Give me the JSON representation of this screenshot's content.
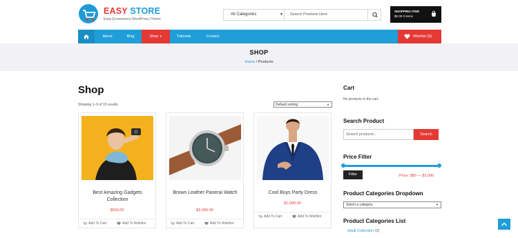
{
  "brand": {
    "name_part1": "EASY",
    "name_part2": "STORE",
    "tagline": "Easy-Ecommerce-WordPress-Theme",
    "colors": {
      "red": "#e53935",
      "blue": "#1e9bd7",
      "dark": "#111111"
    }
  },
  "search": {
    "category_value": "All Categories",
    "placeholder": "Search Products Here"
  },
  "cart": {
    "title": "SHOPPING ITEM",
    "summary": "$0.00 0 items"
  },
  "nav": {
    "items": [
      {
        "label": "About"
      },
      {
        "label": "Blog"
      },
      {
        "label": "Shop"
      },
      {
        "label": "Tutorials"
      },
      {
        "label": "Contact"
      }
    ],
    "active_index": 2,
    "wishlist_label": "Wishlist",
    "wishlist_count": "(0)"
  },
  "banner": {
    "title": "SHOP",
    "crumb_home": "Home",
    "crumb_sep": " / ",
    "crumb_current": "Products"
  },
  "main": {
    "title": "Shop",
    "result_count": "Showing 1–9 of 15 results",
    "sorting": "Default sorting",
    "products": [
      {
        "name": "Best Amazing Gadgets Collection",
        "price": "$500.00",
        "add_to_cart": "Add To Cart",
        "add_to_wishlist": "Add To Wishlist"
      },
      {
        "name": "Brown Leather Panerai Watch",
        "price": "$2,000.00",
        "add_to_cart": "Add To Cart",
        "add_to_wishlist": "Add To Wishlist"
      },
      {
        "name": "Cool Boys Party Dress",
        "price": "$1,000.00",
        "add_to_cart": "Add To Cart",
        "add_to_wishlist": "Add To Wishlist"
      }
    ]
  },
  "sidebar": {
    "cart_heading": "Cart",
    "cart_empty": "No products in the cart.",
    "search_heading": "Search Product",
    "search_placeholder": "Search products...",
    "search_button": "Search",
    "price_heading": "Price Filter",
    "filter_button": "Filter",
    "price_range": "Price: $80 — $2,000",
    "categories_dropdown_heading": "Product Categories Dropdown",
    "categories_dropdown_value": "Select a category",
    "categories_list_heading": "Product Categories List",
    "categories_list": [
      {
        "name": "Adult Collection",
        "count": "(2)"
      }
    ]
  }
}
